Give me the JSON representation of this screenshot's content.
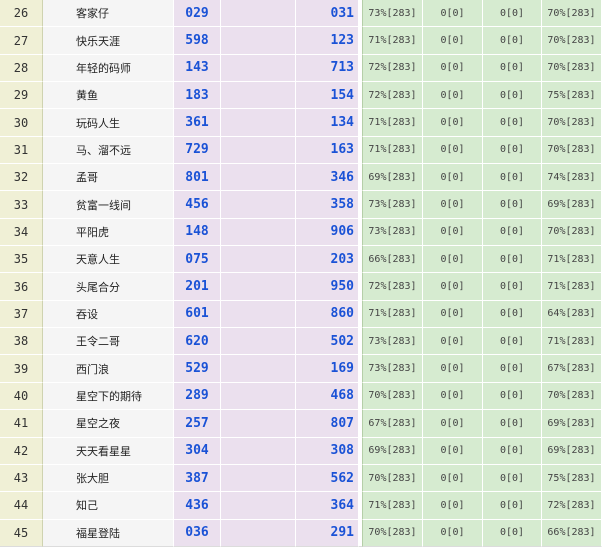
{
  "table": {
    "rows": [
      {
        "rank": "26",
        "name": "客家仔",
        "num1": "029",
        "num2": "031",
        "stat1": "73%[283]",
        "stat2": "0[0]",
        "stat3": "0[0]",
        "stat4": "70%[283]"
      },
      {
        "rank": "27",
        "name": "快乐天涯",
        "num1": "598",
        "num2": "123",
        "stat1": "71%[283]",
        "stat2": "0[0]",
        "stat3": "0[0]",
        "stat4": "70%[283]"
      },
      {
        "rank": "28",
        "name": "年轻的码师",
        "num1": "143",
        "num2": "713",
        "stat1": "72%[283]",
        "stat2": "0[0]",
        "stat3": "0[0]",
        "stat4": "70%[283]"
      },
      {
        "rank": "29",
        "name": "黄鱼",
        "num1": "183",
        "num2": "154",
        "stat1": "72%[283]",
        "stat2": "0[0]",
        "stat3": "0[0]",
        "stat4": "75%[283]"
      },
      {
        "rank": "30",
        "name": "玩码人生",
        "num1": "361",
        "num2": "134",
        "stat1": "71%[283]",
        "stat2": "0[0]",
        "stat3": "0[0]",
        "stat4": "70%[283]"
      },
      {
        "rank": "31",
        "name": "马、溜不远",
        "num1": "729",
        "num2": "163",
        "stat1": "71%[283]",
        "stat2": "0[0]",
        "stat3": "0[0]",
        "stat4": "70%[283]"
      },
      {
        "rank": "32",
        "name": "孟哥",
        "num1": "801",
        "num2": "346",
        "stat1": "69%[283]",
        "stat2": "0[0]",
        "stat3": "0[0]",
        "stat4": "74%[283]"
      },
      {
        "rank": "33",
        "name": "贫富一线间",
        "num1": "456",
        "num2": "358",
        "stat1": "73%[283]",
        "stat2": "0[0]",
        "stat3": "0[0]",
        "stat4": "69%[283]"
      },
      {
        "rank": "34",
        "name": "平阳虎",
        "num1": "148",
        "num2": "906",
        "stat1": "73%[283]",
        "stat2": "0[0]",
        "stat3": "0[0]",
        "stat4": "70%[283]"
      },
      {
        "rank": "35",
        "name": "天意人生",
        "num1": "075",
        "num2": "203",
        "stat1": "66%[283]",
        "stat2": "0[0]",
        "stat3": "0[0]",
        "stat4": "71%[283]"
      },
      {
        "rank": "36",
        "name": "头尾合分",
        "num1": "201",
        "num2": "950",
        "stat1": "72%[283]",
        "stat2": "0[0]",
        "stat3": "0[0]",
        "stat4": "71%[283]"
      },
      {
        "rank": "37",
        "name": "吞设",
        "num1": "601",
        "num2": "860",
        "stat1": "71%[283]",
        "stat2": "0[0]",
        "stat3": "0[0]",
        "stat4": "64%[283]"
      },
      {
        "rank": "38",
        "name": "王令二哥",
        "num1": "620",
        "num2": "502",
        "stat1": "73%[283]",
        "stat2": "0[0]",
        "stat3": "0[0]",
        "stat4": "71%[283]"
      },
      {
        "rank": "39",
        "name": "西门浪",
        "num1": "529",
        "num2": "169",
        "stat1": "73%[283]",
        "stat2": "0[0]",
        "stat3": "0[0]",
        "stat4": "67%[283]"
      },
      {
        "rank": "40",
        "name": "星空下的期待",
        "num1": "289",
        "num2": "468",
        "stat1": "70%[283]",
        "stat2": "0[0]",
        "stat3": "0[0]",
        "stat4": "70%[283]"
      },
      {
        "rank": "41",
        "name": "星空之夜",
        "num1": "257",
        "num2": "807",
        "stat1": "67%[283]",
        "stat2": "0[0]",
        "stat3": "0[0]",
        "stat4": "69%[283]"
      },
      {
        "rank": "42",
        "name": "天天看星星",
        "num1": "304",
        "num2": "308",
        "stat1": "69%[283]",
        "stat2": "0[0]",
        "stat3": "0[0]",
        "stat4": "69%[283]"
      },
      {
        "rank": "43",
        "name": "张大胆",
        "num1": "387",
        "num2": "562",
        "stat1": "70%[283]",
        "stat2": "0[0]",
        "stat3": "0[0]",
        "stat4": "75%[283]"
      },
      {
        "rank": "44",
        "name": "知己",
        "num1": "436",
        "num2": "364",
        "stat1": "71%[283]",
        "stat2": "0[0]",
        "stat3": "0[0]",
        "stat4": "72%[283]"
      },
      {
        "rank": "45",
        "name": "福星登陆",
        "num1": "036",
        "num2": "291",
        "stat1": "70%[283]",
        "stat2": "0[0]",
        "stat3": "0[0]",
        "stat4": "66%[283]"
      }
    ]
  },
  "colors": {
    "number_blue": "#1a52d6",
    "rank_bg": "#f0f0d6",
    "name_bg": "#f5f5f5",
    "number_bg": "#ebe0ee",
    "stat_bg": "#d6ebd0"
  }
}
